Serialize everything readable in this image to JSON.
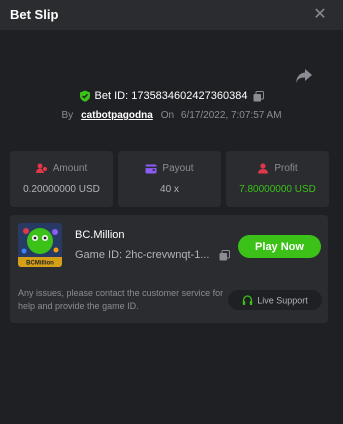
{
  "header": {
    "title": "Bet Slip",
    "close_icon": "close-icon"
  },
  "bet": {
    "id_text": "Bet ID: 173583460242736038​4",
    "by_label": "By",
    "user": "catbotpagodna",
    "on_label": "On",
    "datetime": "6/17/2022, 7:07:57 AM"
  },
  "stats": {
    "amount": {
      "label": "Amount",
      "value": "0.20000000 USD",
      "icon": "amount-icon"
    },
    "payout": {
      "label": "Payout",
      "value": "40 x",
      "icon": "wallet-icon"
    },
    "profit": {
      "label": "Profit",
      "value": "7.80000000 USD",
      "icon": "profit-icon"
    }
  },
  "game": {
    "name": "BC.Million",
    "id_text": "Game ID: 2hc-crevwnqt-1...",
    "thumb_label": "BCMillion",
    "play_label": "Play Now",
    "note": "Any issues, please contact the customer service for help and provide the game ID.",
    "support_label": "Live Support"
  },
  "colors": {
    "accent_green": "#3bc117",
    "background": "#1f2024",
    "card": "#2a2c30",
    "profit_red": "#e0374a",
    "payout_purple": "#8b5cf6"
  }
}
